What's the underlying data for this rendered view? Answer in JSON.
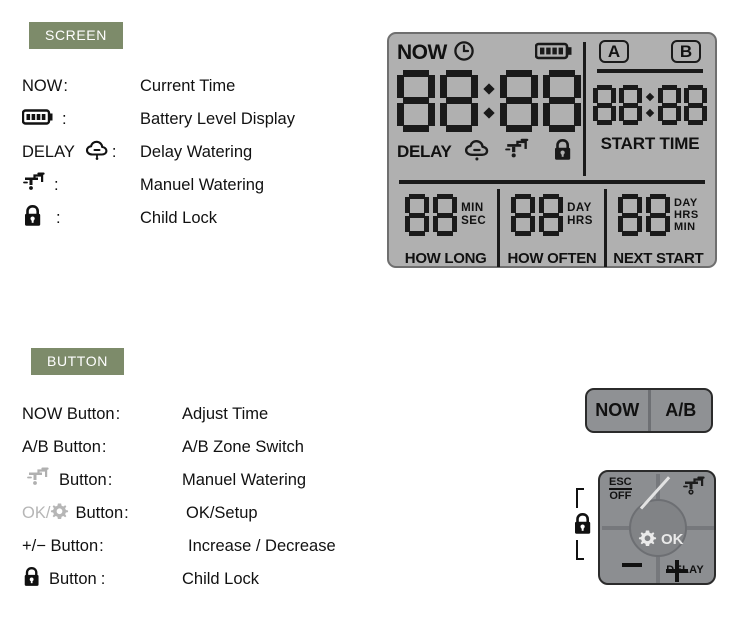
{
  "sections": {
    "screen": {
      "badge": "SCREEN",
      "rows": [
        {
          "term": "NOW",
          "icon": "none",
          "desc": "Current Time"
        },
        {
          "term": "",
          "icon": "battery-icon",
          "desc": "Battery Level Display"
        },
        {
          "term": "DELAY",
          "icon": "cloud-rain-icon",
          "desc": "Delay Watering"
        },
        {
          "term": "",
          "icon": "faucet-icon",
          "desc": "Manuel Watering"
        },
        {
          "term": "",
          "icon": "lock-icon",
          "desc": "Child Lock"
        }
      ]
    },
    "button": {
      "badge": "BUTTON",
      "rows": [
        {
          "term": "NOW Button",
          "icon": "none",
          "desc": "Adjust Time"
        },
        {
          "term": "A/B Button",
          "icon": "none",
          "desc": "A/B Zone Switch"
        },
        {
          "term": "Button",
          "icon": "faucet-icon",
          "desc": "Manuel Watering"
        },
        {
          "term": "Button",
          "icon": "ok-gear-icon",
          "prefix": "OK/",
          "desc": "OK/Setup"
        },
        {
          "term": "+/− Button",
          "icon": "none",
          "desc": "Increase / Decrease"
        },
        {
          "term": "Button",
          "icon": "lock-icon",
          "desc": "Child Lock"
        }
      ],
      "colon": ":"
    }
  },
  "lcd": {
    "now_label": "NOW",
    "clock_icon": "clock-icon",
    "battery_icon": "battery-icon",
    "main_time": "88:88",
    "delay_label": "DELAY",
    "cloud_icon": "cloud-rain-icon",
    "faucet_icon": "faucet-icon",
    "lock_icon": "lock-icon",
    "zone_a": "A",
    "zone_b": "B",
    "start_time_value": "88:88",
    "start_time_label": "START TIME",
    "cells": [
      {
        "value": "88",
        "units": [
          "MIN",
          "SEC"
        ],
        "label": "HOW LONG"
      },
      {
        "value": "88",
        "units": [
          "DAY",
          "HRS"
        ],
        "label": "HOW OFTEN"
      },
      {
        "value": "88",
        "units": [
          "DAY",
          "HRS",
          "MIN"
        ],
        "label": "NEXT START"
      }
    ]
  },
  "hardware": {
    "now_button": "NOW",
    "ab_button": "A/B",
    "pad": {
      "esc": "ESC",
      "off": "OFF",
      "ok": "OK",
      "delay": "DELAY",
      "faucet_icon": "faucet-icon",
      "gear_icon": "gear-icon",
      "lock_icon": "lock-icon",
      "minus": "−",
      "plus": "+"
    }
  },
  "colors": {
    "badge_bg": "#7d8b6a",
    "lcd_bg": "#b0b0b0",
    "lcd_ink": "#1a1a1a",
    "hardware_grey": "#8c8e91",
    "muted_grey": "#b6b6b6"
  }
}
